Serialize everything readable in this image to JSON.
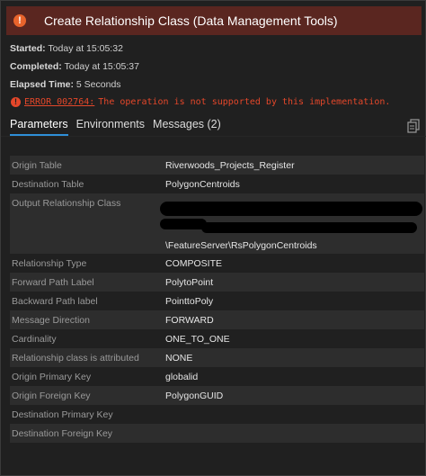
{
  "dialog": {
    "title": "Create Relationship Class (Data Management Tools)",
    "title_icon": "warning-circle-icon"
  },
  "meta": {
    "started_label": "Started:",
    "started_value": "Today at 15:05:32",
    "completed_label": "Completed:",
    "completed_value": "Today at 15:05:37",
    "elapsed_label": "Elapsed Time:",
    "elapsed_value": "5 Seconds"
  },
  "error": {
    "code": "ERROR 002764:",
    "message": "The operation is not supported by this implementation."
  },
  "tabs": [
    {
      "label": "Parameters",
      "active": true
    },
    {
      "label": "Environments",
      "active": false
    },
    {
      "label": "Messages (2)",
      "active": false
    }
  ],
  "params": [
    {
      "label": "Origin Table",
      "value": "Riverwoods_Projects_Register"
    },
    {
      "label": "Destination Table",
      "value": "PolygonCentroids"
    },
    {
      "label": "Output Relationship Class",
      "value": "\\FeatureServer\\RsPolygonCentroids"
    },
    {
      "label": "Relationship Type",
      "value": "COMPOSITE"
    },
    {
      "label": "Forward Path Label",
      "value": "PolytoPoint"
    },
    {
      "label": "Backward Path label",
      "value": "PointtoPoly"
    },
    {
      "label": "Message Direction",
      "value": "FORWARD"
    },
    {
      "label": "Cardinality",
      "value": "ONE_TO_ONE"
    },
    {
      "label": "Relationship class is attributed",
      "value": "NONE"
    },
    {
      "label": "Origin Primary Key",
      "value": "globalid"
    },
    {
      "label": "Origin Foreign Key",
      "value": "PolygonGUID"
    },
    {
      "label": "Destination Primary Key",
      "value": ""
    },
    {
      "label": "Destination Foreign Key",
      "value": ""
    }
  ],
  "colors": {
    "title_bar": "#5a2620",
    "error": "#e4472a",
    "active_tab_underline": "#2f8fd8"
  }
}
